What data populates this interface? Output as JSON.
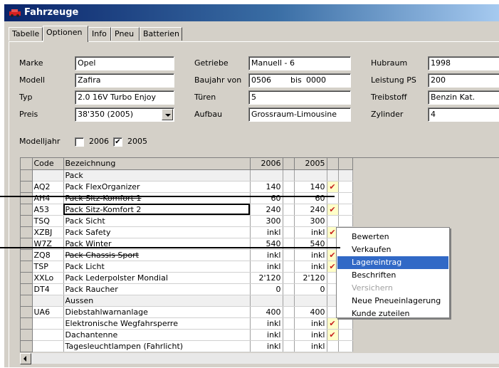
{
  "window": {
    "title": "Fahrzeuge"
  },
  "tabs": [
    "Tabelle",
    "Optionen",
    "Info",
    "Pneu",
    "Batterien"
  ],
  "form": {
    "marke_label": "Marke",
    "marke": "Opel",
    "modell_label": "Modell",
    "modell": "Zafira",
    "typ_label": "Typ",
    "typ": "2.0 16V Turbo Enjoy",
    "preis_label": "Preis",
    "preis": "38'350 (2005)",
    "getriebe_label": "Getriebe",
    "getriebe": "Manuell - 6",
    "baujahr_label": "Baujahr von",
    "baujahr_von": "0506",
    "bis_label": "bis",
    "baujahr_bis": "0000",
    "tueren_label": "Türen",
    "tueren": "5",
    "aufbau_label": "Aufbau",
    "aufbau": "Grossraum-Limousine",
    "hubraum_label": "Hubraum",
    "hubraum": "1998",
    "leistung_label": "Leistung PS",
    "leistung": "200",
    "treibstoff_label": "Treibstoff",
    "treibstoff": "Benzin Kat.",
    "zylinder_label": "Zylinder",
    "zylinder": "4",
    "modelljahr_label": "Modelljahr",
    "year1": "2006",
    "year1_checked": false,
    "year2": "2005",
    "year2_checked": true,
    "check_mark": "✔"
  },
  "table": {
    "headers": [
      "Code",
      "Bezeichnung",
      "2006",
      "2005"
    ],
    "rows": [
      {
        "code": "",
        "name": "Pack",
        "v2006": "",
        "v2005": "",
        "ok": "",
        "group": true
      },
      {
        "code": "AQ2",
        "name": "Pack FlexOrganizer",
        "v2006": "140",
        "v2005": "140",
        "ok": "✔"
      },
      {
        "code": "AH4",
        "name": "Pack Sitz-Komfort 1",
        "v2006": "60",
        "v2005": "60",
        "ok": "",
        "strike": true
      },
      {
        "code": "A53",
        "name": "Pack Sitz-Komfort 2",
        "v2006": "240",
        "v2005": "240",
        "ok": "✔",
        "focus": true
      },
      {
        "code": "TSQ",
        "name": "Pack Sicht",
        "v2006": "300",
        "v2005": "300",
        "ok": ""
      },
      {
        "code": "XZBJ",
        "name": "Pack Safety",
        "v2006": "inkl",
        "v2005": "inkl",
        "ok": "✔"
      },
      {
        "code": "W7Z",
        "name": "Pack Winter",
        "v2006": "540",
        "v2005": "540",
        "ok": ""
      },
      {
        "code": "ZQ8",
        "name": "Pack Chassis Sport",
        "v2006": "inkl",
        "v2005": "inkl",
        "ok": "✔",
        "strike": true
      },
      {
        "code": "TSP",
        "name": "Pack Licht",
        "v2006": "inkl",
        "v2005": "inkl",
        "ok": "✔"
      },
      {
        "code": "XXLo",
        "name": "Pack Lederpolster Mondial",
        "v2006": "2'120",
        "v2005": "2'120",
        "ok": ""
      },
      {
        "code": "DT4",
        "name": "Pack Raucher",
        "v2006": "0",
        "v2005": "0",
        "ok": ""
      },
      {
        "code": "",
        "name": "Aussen",
        "v2006": "",
        "v2005": "",
        "ok": "",
        "group": true
      },
      {
        "code": "UA6",
        "name": "Diebstahlwarnanlage",
        "v2006": "400",
        "v2005": "400",
        "ok": ""
      },
      {
        "code": "",
        "name": "Elektronische Wegfahrsperre",
        "v2006": "inkl",
        "v2005": "inkl",
        "ok": "✔"
      },
      {
        "code": "",
        "name": "Dachantenne",
        "v2006": "inkl",
        "v2005": "inkl",
        "ok": "✔"
      },
      {
        "code": "",
        "name": "Tagesleuchtlampen (Fahrlicht)",
        "v2006": "inkl",
        "v2005": "inkl",
        "ok": ""
      }
    ]
  },
  "context_menu": [
    "Bewerten",
    "Verkaufen",
    "Lagereintrag",
    "Beschriften",
    "Versichern",
    "Neue Pneueinlagerung",
    "Kunde zuteilen"
  ],
  "colors": {
    "title_start": "#0a246a",
    "title_end": "#a6caf0",
    "check": "#c81e1e",
    "check_bg": "#ffffc8",
    "menu_highlight": "#3169c6"
  }
}
